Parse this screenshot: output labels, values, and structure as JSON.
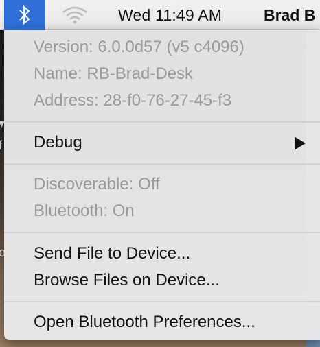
{
  "menubar": {
    "bluetooth_icon": "bluetooth-icon",
    "wifi_icon": "wifi-icon",
    "clock": "Wed 11:49 AM",
    "user": "Brad B"
  },
  "device_info": {
    "version": "Version: 6.0.0d57 (v5 c4096)",
    "name": "Name: RB-Brad-Desk",
    "address": "Address: 28-f0-76-27-45-f3"
  },
  "debug": {
    "label": "Debug",
    "submenu_icon": "submenu-arrow-icon"
  },
  "status": {
    "discoverable": "Discoverable: Off",
    "bluetooth": "Bluetooth: On"
  },
  "actions": {
    "send_file": "Send File to Device...",
    "browse_files": "Browse Files on Device..."
  },
  "preferences": {
    "label": "Open Bluetooth Preferences..."
  },
  "colors": {
    "tray_highlight": "#2f6fd8",
    "disabled_text": "#9a9a9a",
    "enabled_text": "#111111"
  }
}
